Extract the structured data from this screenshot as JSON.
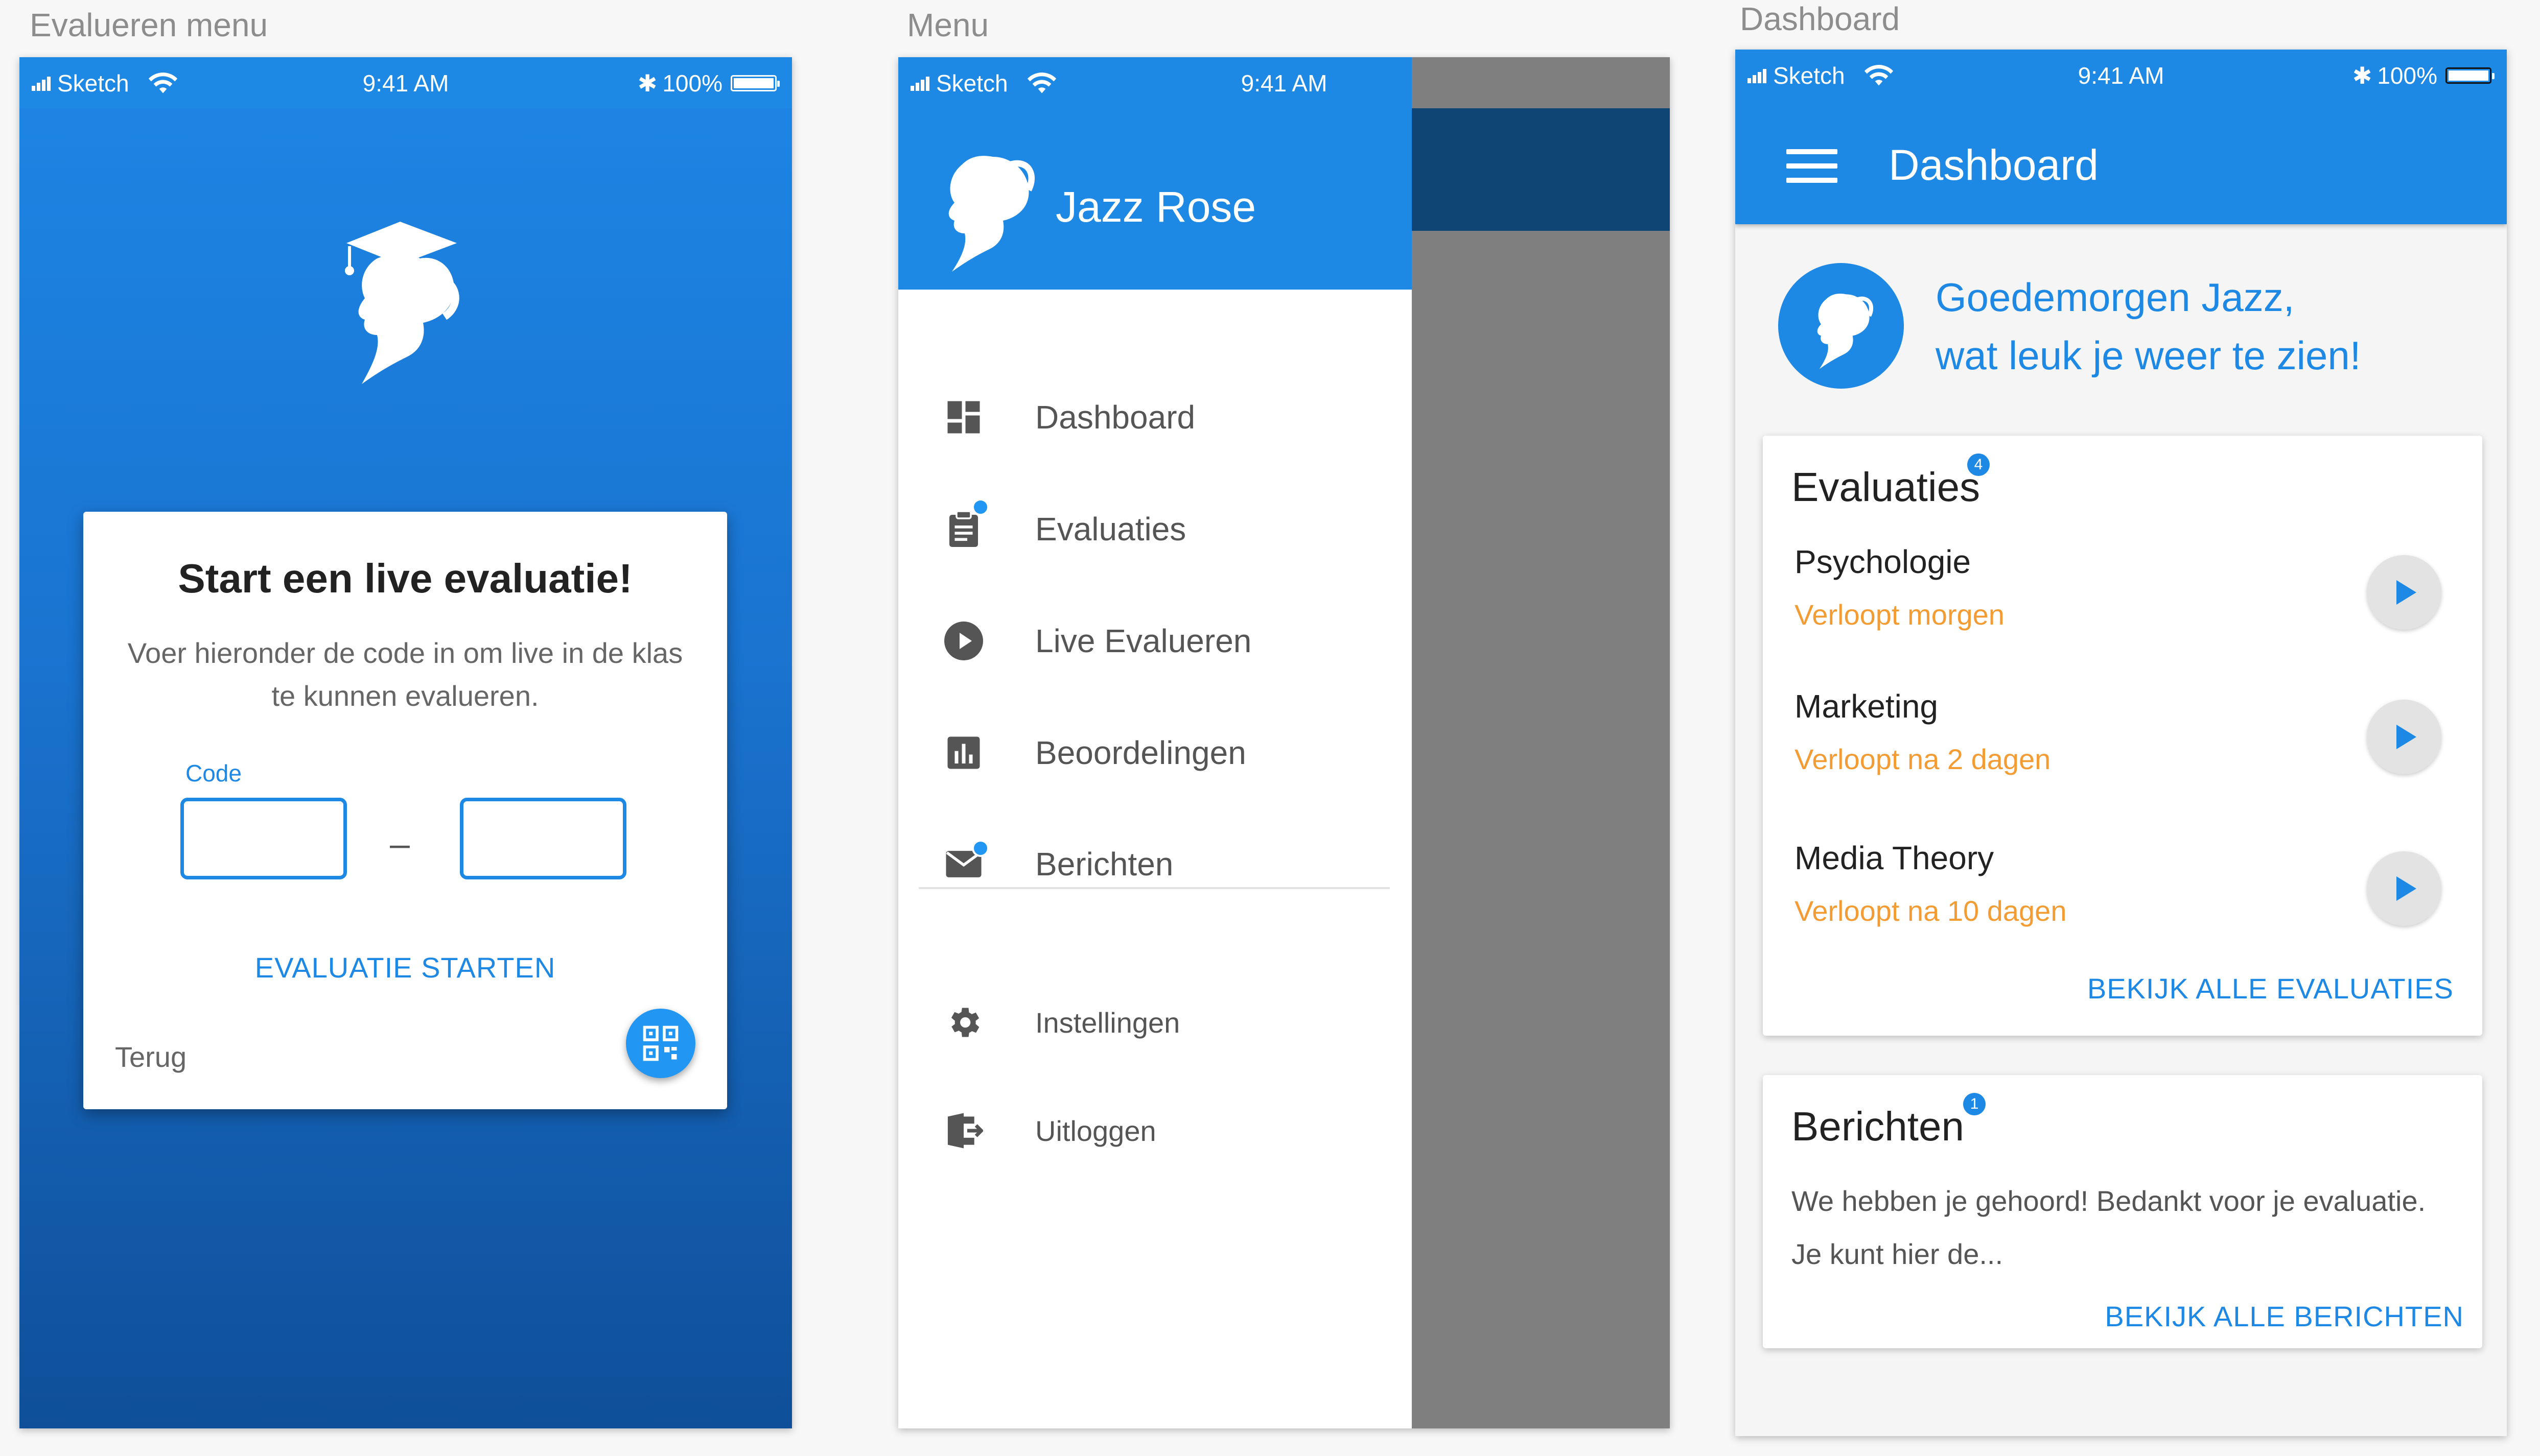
{
  "artboards": {
    "evalueren": "Evalueren menu",
    "menu": "Menu",
    "dashboard": "Dashboard"
  },
  "statusbar": {
    "carrier": "Sketch",
    "time": "9:41 AM",
    "battery": "100%"
  },
  "evaluate_screen": {
    "title": "Start een live evaluatie!",
    "description": "Voer hieronder de code in om live in de klas te kunnen evalueren.",
    "code_label": "Code",
    "code_value_1": "",
    "code_value_2": "",
    "separator": "–",
    "start_label": "EVALUATIE STARTEN",
    "back_label": "Terug",
    "qr_icon": "qr-code-icon"
  },
  "menu_screen": {
    "user_name": "Jazz Rose",
    "items": [
      {
        "label": "Dashboard",
        "icon": "dashboard-icon"
      },
      {
        "label": "Evaluaties",
        "icon": "clipboard-icon"
      },
      {
        "label": "Live Evalueren",
        "icon": "play-circle-icon"
      },
      {
        "label": "Beoordelingen",
        "icon": "bar-chart-icon"
      },
      {
        "label": "Berichten",
        "icon": "mail-icon"
      }
    ],
    "secondary_items": [
      {
        "label": "Instellingen",
        "icon": "gear-icon"
      },
      {
        "label": "Uitloggen",
        "icon": "logout-icon"
      }
    ]
  },
  "dashboard_screen": {
    "title": "Dashboard",
    "greeting_line1": "Goedemorgen Jazz,",
    "greeting_line2": "wat leuk je weer te zien!",
    "evaluations": {
      "title": "Evaluaties",
      "badge": "4",
      "items": [
        {
          "name": "Psychologie",
          "due": "Verloopt morgen"
        },
        {
          "name": "Marketing",
          "due": "Verloopt na 2 dagen"
        },
        {
          "name": "Media Theory",
          "due": "Verloopt na 10 dagen"
        }
      ],
      "more_label": "BEKIJK ALLE EVALUATIES"
    },
    "messages": {
      "title": "Berichten",
      "badge": "1",
      "preview": "We hebben je gehoord! Bedankt voor je evaluatie. Je kunt hier de...",
      "more_label": "BEKIJK ALLE BERICHTEN"
    }
  },
  "colors": {
    "primary": "#1e88e5",
    "accent_orange": "#f39c34",
    "dark_blue": "#0e4574"
  }
}
